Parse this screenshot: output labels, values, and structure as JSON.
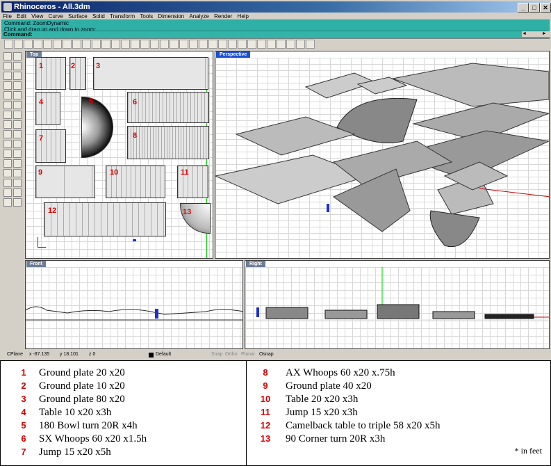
{
  "window": {
    "title": "Rhinoceros - All.3dm"
  },
  "menu": [
    "File",
    "Edit",
    "View",
    "Curve",
    "Surface",
    "Solid",
    "Transform",
    "Tools",
    "Dimension",
    "Analyze",
    "Render",
    "Help"
  ],
  "command_history": [
    "Command: ZoomDynamic",
    "Click and drag up and down to zoom:"
  ],
  "command_prompt": "Command:",
  "viewports": {
    "top": "Top",
    "perspective": "Perspective",
    "front": "Front",
    "right": "Right"
  },
  "status_bar": {
    "cplane": "CPlane",
    "x": "x -87.135",
    "y": "y 18.101",
    "z": "z 0",
    "layer": "Default",
    "snap": "Snap",
    "ortho": "Ortho",
    "planar": "Planar",
    "osnap": "Osnap"
  },
  "top_view_labels": [
    "1",
    "2",
    "3",
    "4",
    "5",
    "6",
    "7",
    "8",
    "9",
    "10",
    "11",
    "12",
    "13"
  ],
  "legend": {
    "left": [
      {
        "num": "1",
        "text": "Ground plate 20 x20"
      },
      {
        "num": "2",
        "text": "Ground plate 10 x20"
      },
      {
        "num": "3",
        "text": "Ground plate 80 x20"
      },
      {
        "num": "4",
        "text": "Table 10 x20 x3h"
      },
      {
        "num": "5",
        "text": "180 Bowl turn 20R x4h"
      },
      {
        "num": "6",
        "text": "SX Whoops  60 x20 x1.5h"
      },
      {
        "num": "7",
        "text": "Jump 15 x20 x5h"
      }
    ],
    "right": [
      {
        "num": "8",
        "text": "AX Whoops  60 x20 x.75h"
      },
      {
        "num": "9",
        "text": "Ground plate 40 x20"
      },
      {
        "num": "10",
        "text": "Table 20 x20 x3h"
      },
      {
        "num": "11",
        "text": "Jump 15 x20 x3h"
      },
      {
        "num": "12",
        "text": "Camelback table to triple 58  x20 x5h"
      },
      {
        "num": "13",
        "text": "90 Corner turn 20R x3h"
      }
    ],
    "note": "* in feet"
  }
}
